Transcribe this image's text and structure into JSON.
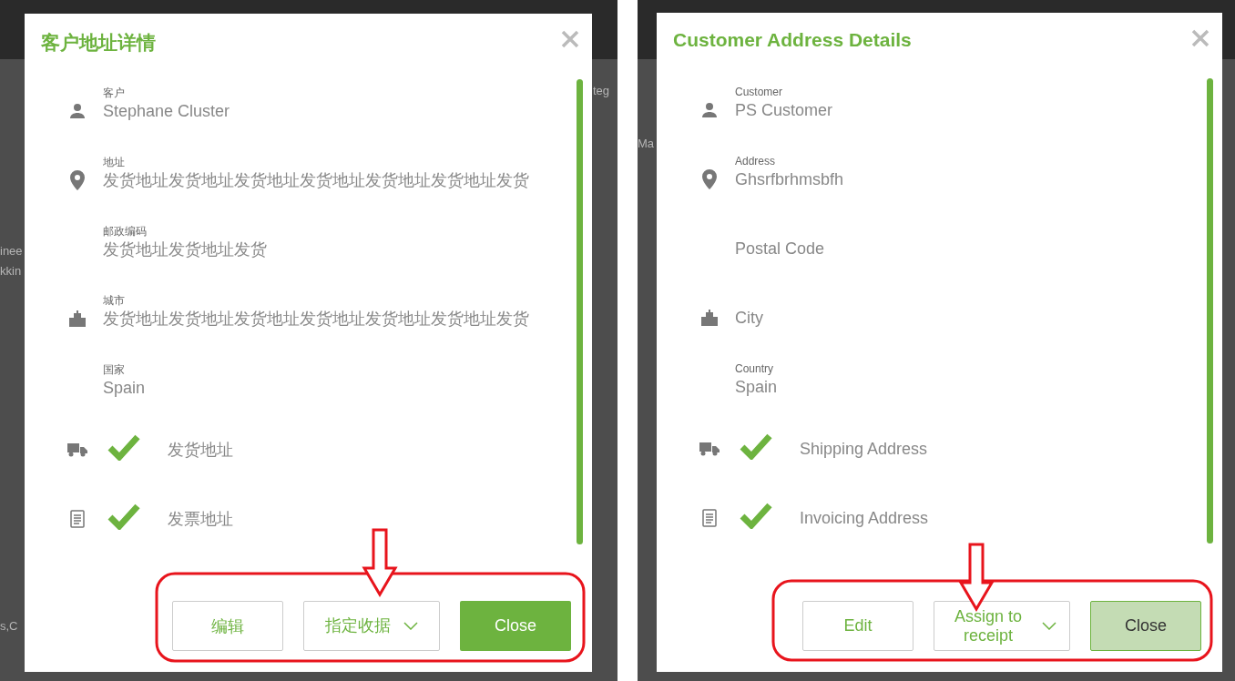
{
  "panels": [
    {
      "background_texts": [
        "teg",
        "inee",
        "kkin",
        "s,C"
      ],
      "dialog": {
        "title": "客户地址详情",
        "rows": [
          {
            "kind": "field",
            "label": "客户",
            "value": "Stephane Cluster"
          },
          {
            "kind": "field",
            "label": "地址",
            "value": "发货地址发货地址发货地址发货地址发货地址发货地址发货"
          },
          {
            "kind": "field",
            "label": "邮政编码",
            "value": "发货地址发货地址发货"
          },
          {
            "kind": "field",
            "label": "城市",
            "value": "发货地址发货地址发货地址发货地址发货地址发货地址发货"
          },
          {
            "kind": "field",
            "label": "国家",
            "value": "Spain"
          },
          {
            "kind": "check",
            "checked": true,
            "value": "发货地址"
          },
          {
            "kind": "check",
            "checked": true,
            "value": "发票地址"
          }
        ],
        "buttons": [
          {
            "kind": "outline",
            "label": "编辑"
          },
          {
            "kind": "dropdown",
            "label": "指定收据"
          },
          {
            "kind": "primary",
            "label": "Close",
            "disabled": false
          }
        ]
      }
    },
    {
      "background_texts": [
        "Ma"
      ],
      "dialog": {
        "title": "Customer Address Details",
        "rows": [
          {
            "kind": "field",
            "label": "Customer",
            "value": "PS Customer"
          },
          {
            "kind": "field",
            "label": "Address",
            "value": "Ghsrfbrhmsbfh"
          },
          {
            "kind": "field",
            "value": "Postal Code"
          },
          {
            "kind": "field",
            "value": "City"
          },
          {
            "kind": "field",
            "label": "Country",
            "value": "Spain"
          },
          {
            "kind": "check",
            "checked": true,
            "value": "Shipping Address"
          },
          {
            "kind": "check",
            "checked": true,
            "value": "Invoicing Address"
          }
        ],
        "buttons": [
          {
            "kind": "outline",
            "label": "Edit"
          },
          {
            "kind": "dropdown",
            "label": "Assign to receipt"
          },
          {
            "kind": "primary",
            "label": "Close",
            "disabled": true
          }
        ]
      }
    }
  ]
}
